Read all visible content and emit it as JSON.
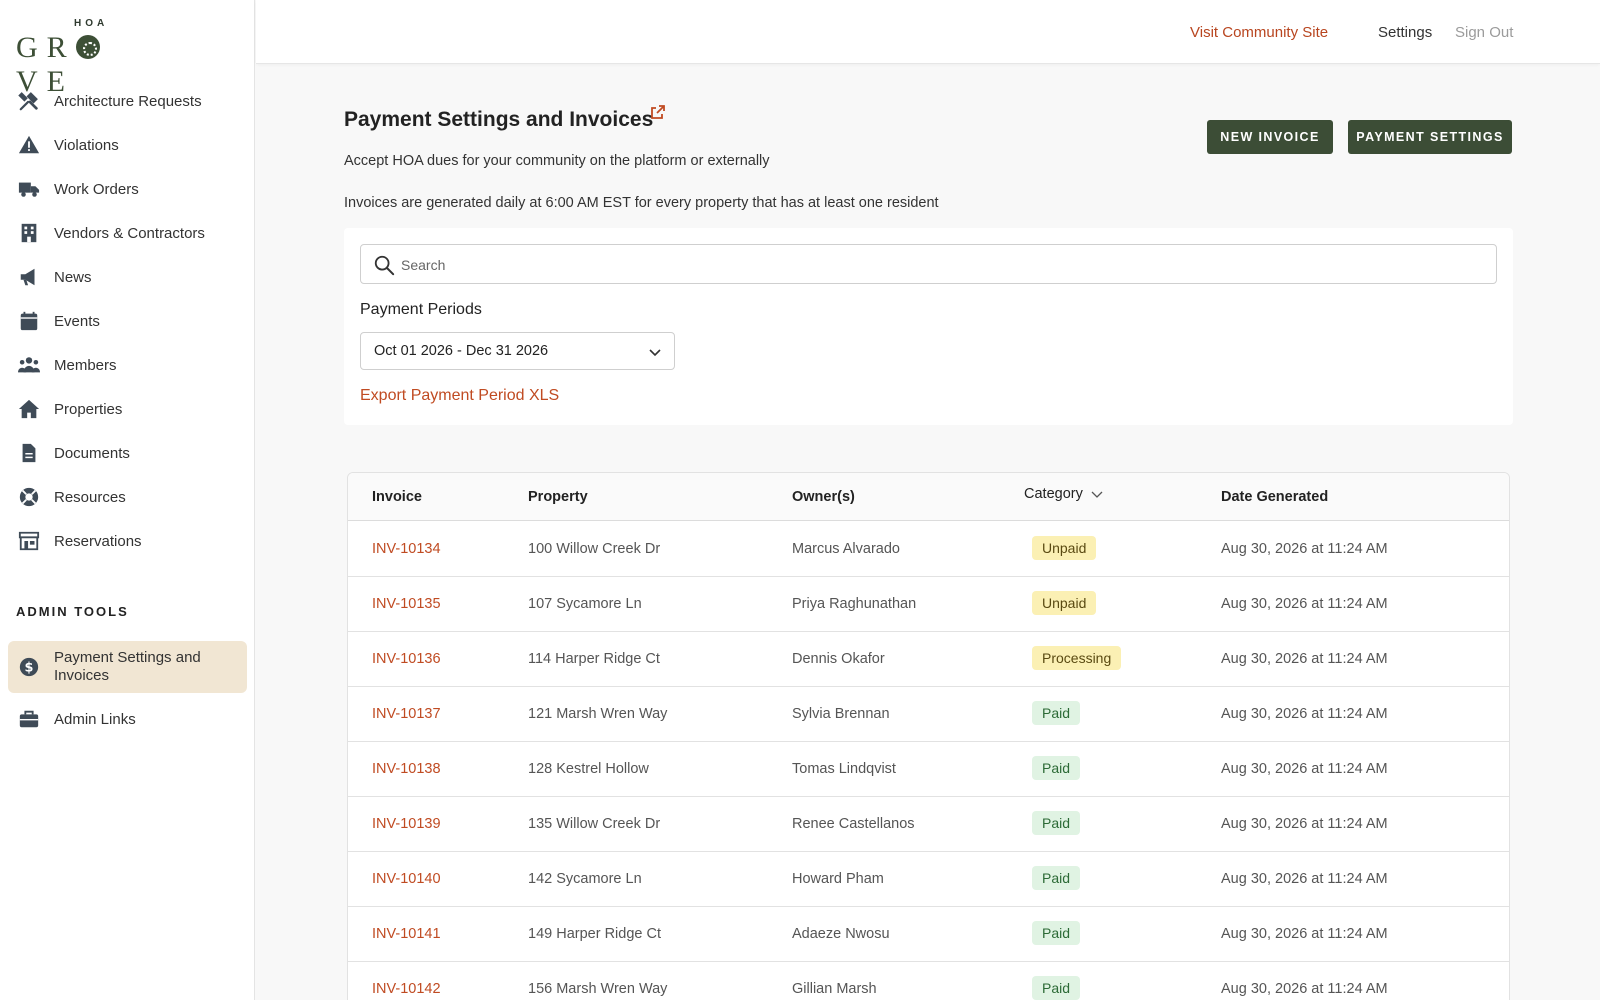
{
  "logo": {
    "small": "HOA",
    "word": "GROVE"
  },
  "sidebar": {
    "items": [
      {
        "label": "Architecture Requests",
        "icon": "tools-icon"
      },
      {
        "label": "Violations",
        "icon": "warning-icon"
      },
      {
        "label": "Work Orders",
        "icon": "truck-icon"
      },
      {
        "label": "Vendors & Contractors",
        "icon": "building-icon"
      },
      {
        "label": "News",
        "icon": "megaphone-icon"
      },
      {
        "label": "Events",
        "icon": "calendar-icon"
      },
      {
        "label": "Members",
        "icon": "people-icon"
      },
      {
        "label": "Properties",
        "icon": "home-icon"
      },
      {
        "label": "Documents",
        "icon": "document-icon"
      },
      {
        "label": "Resources",
        "icon": "lifebuoy-icon"
      },
      {
        "label": "Reservations",
        "icon": "store-icon"
      }
    ],
    "admin_title": "ADMIN TOOLS",
    "admin_items": [
      {
        "label": "Payment Settings and Invoices",
        "icon": "dollar-icon",
        "active": true
      },
      {
        "label": "Admin Links",
        "icon": "briefcase-icon"
      }
    ]
  },
  "topbar": {
    "visit": "Visit Community Site",
    "settings": "Settings",
    "signout": "Sign Out"
  },
  "page": {
    "title": "Payment Settings and Invoices",
    "subtitle": "Accept HOA dues for your community on the platform or externally",
    "note": "Invoices are generated daily at 6:00 AM EST for every property that has at least one resident",
    "new_invoice": "NEW INVOICE",
    "payment_settings": "PAYMENT SETTINGS"
  },
  "filters": {
    "search_placeholder": "Search",
    "periods_label": "Payment Periods",
    "period_value": "Oct 01 2026 - Dec 31 2026",
    "export": "Export Payment Period XLS"
  },
  "table": {
    "headers": {
      "invoice": "Invoice",
      "property": "Property",
      "owner": "Owner(s)",
      "category": "Category",
      "date": "Date Generated"
    },
    "rows": [
      {
        "invoice": "INV-10134",
        "property": "100 Willow Creek Dr",
        "owner": "Marcus Alvarado",
        "status": "Unpaid",
        "date": "Aug 30, 2026 at 11:24 AM"
      },
      {
        "invoice": "INV-10135",
        "property": "107 Sycamore Ln",
        "owner": "Priya Raghunathan",
        "status": "Unpaid",
        "date": "Aug 30, 2026 at 11:24 AM"
      },
      {
        "invoice": "INV-10136",
        "property": "114 Harper Ridge Ct",
        "owner": "Dennis Okafor",
        "status": "Processing",
        "date": "Aug 30, 2026 at 11:24 AM"
      },
      {
        "invoice": "INV-10137",
        "property": "121 Marsh Wren Way",
        "owner": "Sylvia Brennan",
        "status": "Paid",
        "date": "Aug 30, 2026 at 11:24 AM"
      },
      {
        "invoice": "INV-10138",
        "property": "128 Kestrel Hollow",
        "owner": "Tomas Lindqvist",
        "status": "Paid",
        "date": "Aug 30, 2026 at 11:24 AM"
      },
      {
        "invoice": "INV-10139",
        "property": "135 Willow Creek Dr",
        "owner": "Renee Castellanos",
        "status": "Paid",
        "date": "Aug 30, 2026 at 11:24 AM"
      },
      {
        "invoice": "INV-10140",
        "property": "142 Sycamore Ln",
        "owner": "Howard Pham",
        "status": "Paid",
        "date": "Aug 30, 2026 at 11:24 AM"
      },
      {
        "invoice": "INV-10141",
        "property": "149 Harper Ridge Ct",
        "owner": "Adaeze Nwosu",
        "status": "Paid",
        "date": "Aug 30, 2026 at 11:24 AM"
      },
      {
        "invoice": "INV-10142",
        "property": "156 Marsh Wren Way",
        "owner": "Gillian Marsh",
        "status": "Paid",
        "date": "Aug 30, 2026 at 11:24 AM"
      }
    ]
  },
  "colors": {
    "accent": "#c04b22",
    "brand": "#3c4d36",
    "active_bg": "#f1e6d3"
  }
}
